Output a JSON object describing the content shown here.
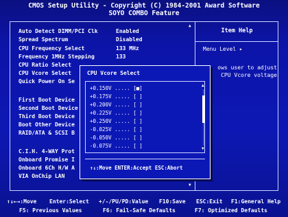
{
  "header": {
    "line1": "CMOS Setup Utility - Copyright (C) 1984-2001 Award Software",
    "line2": "SOYO COMBO Feature"
  },
  "settings": [
    {
      "label": "Auto Detect DIMM/PCI Clk",
      "value": "Enabled"
    },
    {
      "label": "Spread Spectrum",
      "value": "Disabled"
    },
    {
      "label": "CPU Frequency Select",
      "value": "133 MHz"
    },
    {
      "label": "Frequency 1MHz Stepping",
      "value": "133"
    },
    {
      "label": "CPU Ratio Select",
      "value": ""
    },
    {
      "label": "CPU Vcore Select",
      "value": ""
    },
    {
      "label": "Quick Power On Se",
      "value": ""
    },
    {
      "label": "First Boot Device",
      "value": ""
    },
    {
      "label": "Second Boot Device",
      "value": ""
    },
    {
      "label": "Third Boot Device",
      "value": ""
    },
    {
      "label": "Boot Other Device",
      "value": ""
    },
    {
      "label": "RAID/ATA & SCSI B",
      "value": ""
    },
    {
      "label": "C.I.H. 4-WAY Prot",
      "value": ""
    },
    {
      "label": "Onboard Promise I",
      "value": ""
    },
    {
      "label": "Onboard 6Ch H/W A",
      "value": ""
    },
    {
      "label": "VIA OnChip LAN",
      "value": ""
    }
  ],
  "help": {
    "title": "Item Help",
    "menu_level": "Menu Level   ▸",
    "desc_line1": "ows user to adjust",
    "desc_line2": "CPU Vcore voltage"
  },
  "popup": {
    "title": "CPU Vcore Select",
    "options": [
      {
        "label": "+0.150V  ..... [■]"
      },
      {
        "label": "+0.175V  ..... [ ]"
      },
      {
        "label": "+0.200V  ..... [ ]"
      },
      {
        "label": "+0.225V  ..... [ ]"
      },
      {
        "label": "+0.250V  ..... [ ]"
      },
      {
        "label": "-0.025V  ..... [ ]"
      },
      {
        "label": "-0.050V  ..... [ ]"
      },
      {
        "label": "-0.075V  ..... [ ]"
      }
    ],
    "footer": "↑↓:Move ENTER:Accept ESC:Abort"
  },
  "footer": {
    "row1": {
      "move": "↑↓←→:Move",
      "select": "Enter:Select",
      "value": "+/-/PU/PD:Value",
      "save": "F10:Save",
      "exit": "ESC:Exit",
      "help": "F1:General Help"
    },
    "row2": {
      "prev": "F5: Previous Values",
      "failsafe": "F6: Fail-Safe Defaults",
      "optimized": "F7: Optimized Defaults"
    }
  },
  "colors": {
    "background": "#0c14a8",
    "text": "#ffffff",
    "border": "#cfd6ff"
  }
}
